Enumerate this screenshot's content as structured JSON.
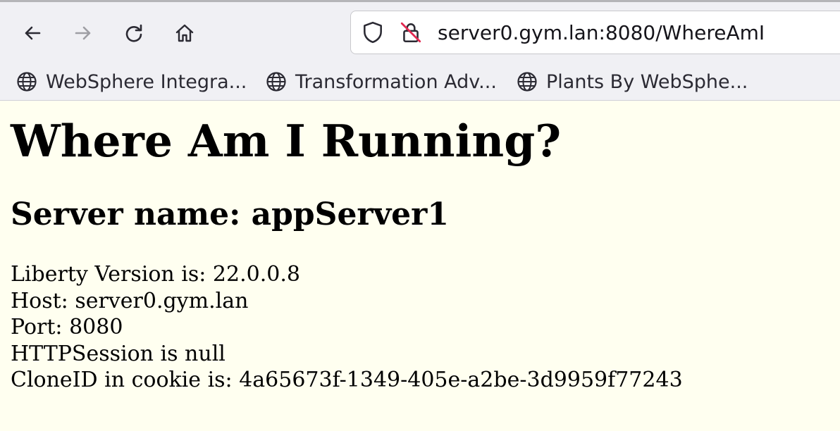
{
  "browser": {
    "url": "server0.gym.lan:8080/WhereAmI",
    "bookmarks": [
      {
        "label": "WebSphere Integra..."
      },
      {
        "label": "Transformation Adv..."
      },
      {
        "label": "Plants By WebSphe..."
      }
    ],
    "icons": {
      "back": "arrow-left-icon",
      "forward": "arrow-right-icon",
      "reload": "reload-icon",
      "home": "home-icon",
      "shield": "shield-icon",
      "lock": "insecure-lock-icon",
      "globe": "globe-icon"
    }
  },
  "page": {
    "title": "Where Am I Running?",
    "server_name": "Server name: appServer1",
    "info": [
      "Liberty Version is: 22.0.0.8",
      "Host: server0.gym.lan",
      "Port: 8080",
      "HTTPSession is null",
      "CloneID in cookie is: 4a65673f-1349-405e-a2be-3d9959f77243"
    ]
  },
  "colors": {
    "page_background": "#fffff0",
    "toolbar_background": "#f0f0f4",
    "insecure_slash": "#e22850"
  }
}
